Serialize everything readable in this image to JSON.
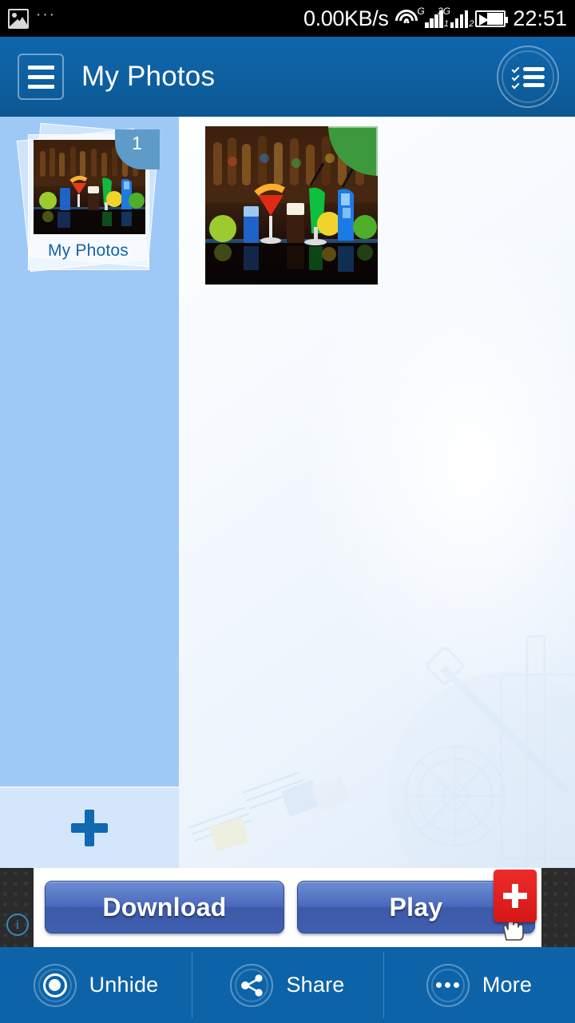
{
  "status_bar": {
    "notification_icon": "image-icon",
    "overflow_icon": "ellipsis-icon",
    "network_speed": "0.00KB/s",
    "wifi_icon": "wifi-icon",
    "sim1_label": "G",
    "sim1_index": "1",
    "sim2_label": "3G",
    "sim2_index": "2",
    "battery_icon": "battery-charging-icon",
    "clock": "22:51"
  },
  "header": {
    "menu_icon": "hamburger-menu-icon",
    "title": "My Photos",
    "select_icon": "checklist-select-icon",
    "background_color": "#0d5f9f"
  },
  "sidebar": {
    "background_color": "#9ec9f7",
    "albums": [
      {
        "name": "My Photos",
        "count": "1",
        "selected": true
      }
    ],
    "add_album": {
      "icon": "plus-icon",
      "label": ""
    }
  },
  "content": {
    "photos": [
      {
        "name": "cocktails-photo",
        "selected": true,
        "selection_color": "#3c9a3c"
      }
    ]
  },
  "ad": {
    "info_icon": "ad-choices-info-icon",
    "download_label": "Download",
    "play_label": "Play",
    "plus_badge": "+",
    "cursor_icon": "hand-cursor-icon",
    "accent_color": "#4a69bd",
    "badge_color": "#d41717"
  },
  "bottom_nav": {
    "background_color": "#0d63a8",
    "items": [
      {
        "label": "Unhide",
        "icon": "eye-icon"
      },
      {
        "label": "Share",
        "icon": "share-icon"
      },
      {
        "label": "More",
        "icon": "ellipsis-icon"
      }
    ]
  }
}
